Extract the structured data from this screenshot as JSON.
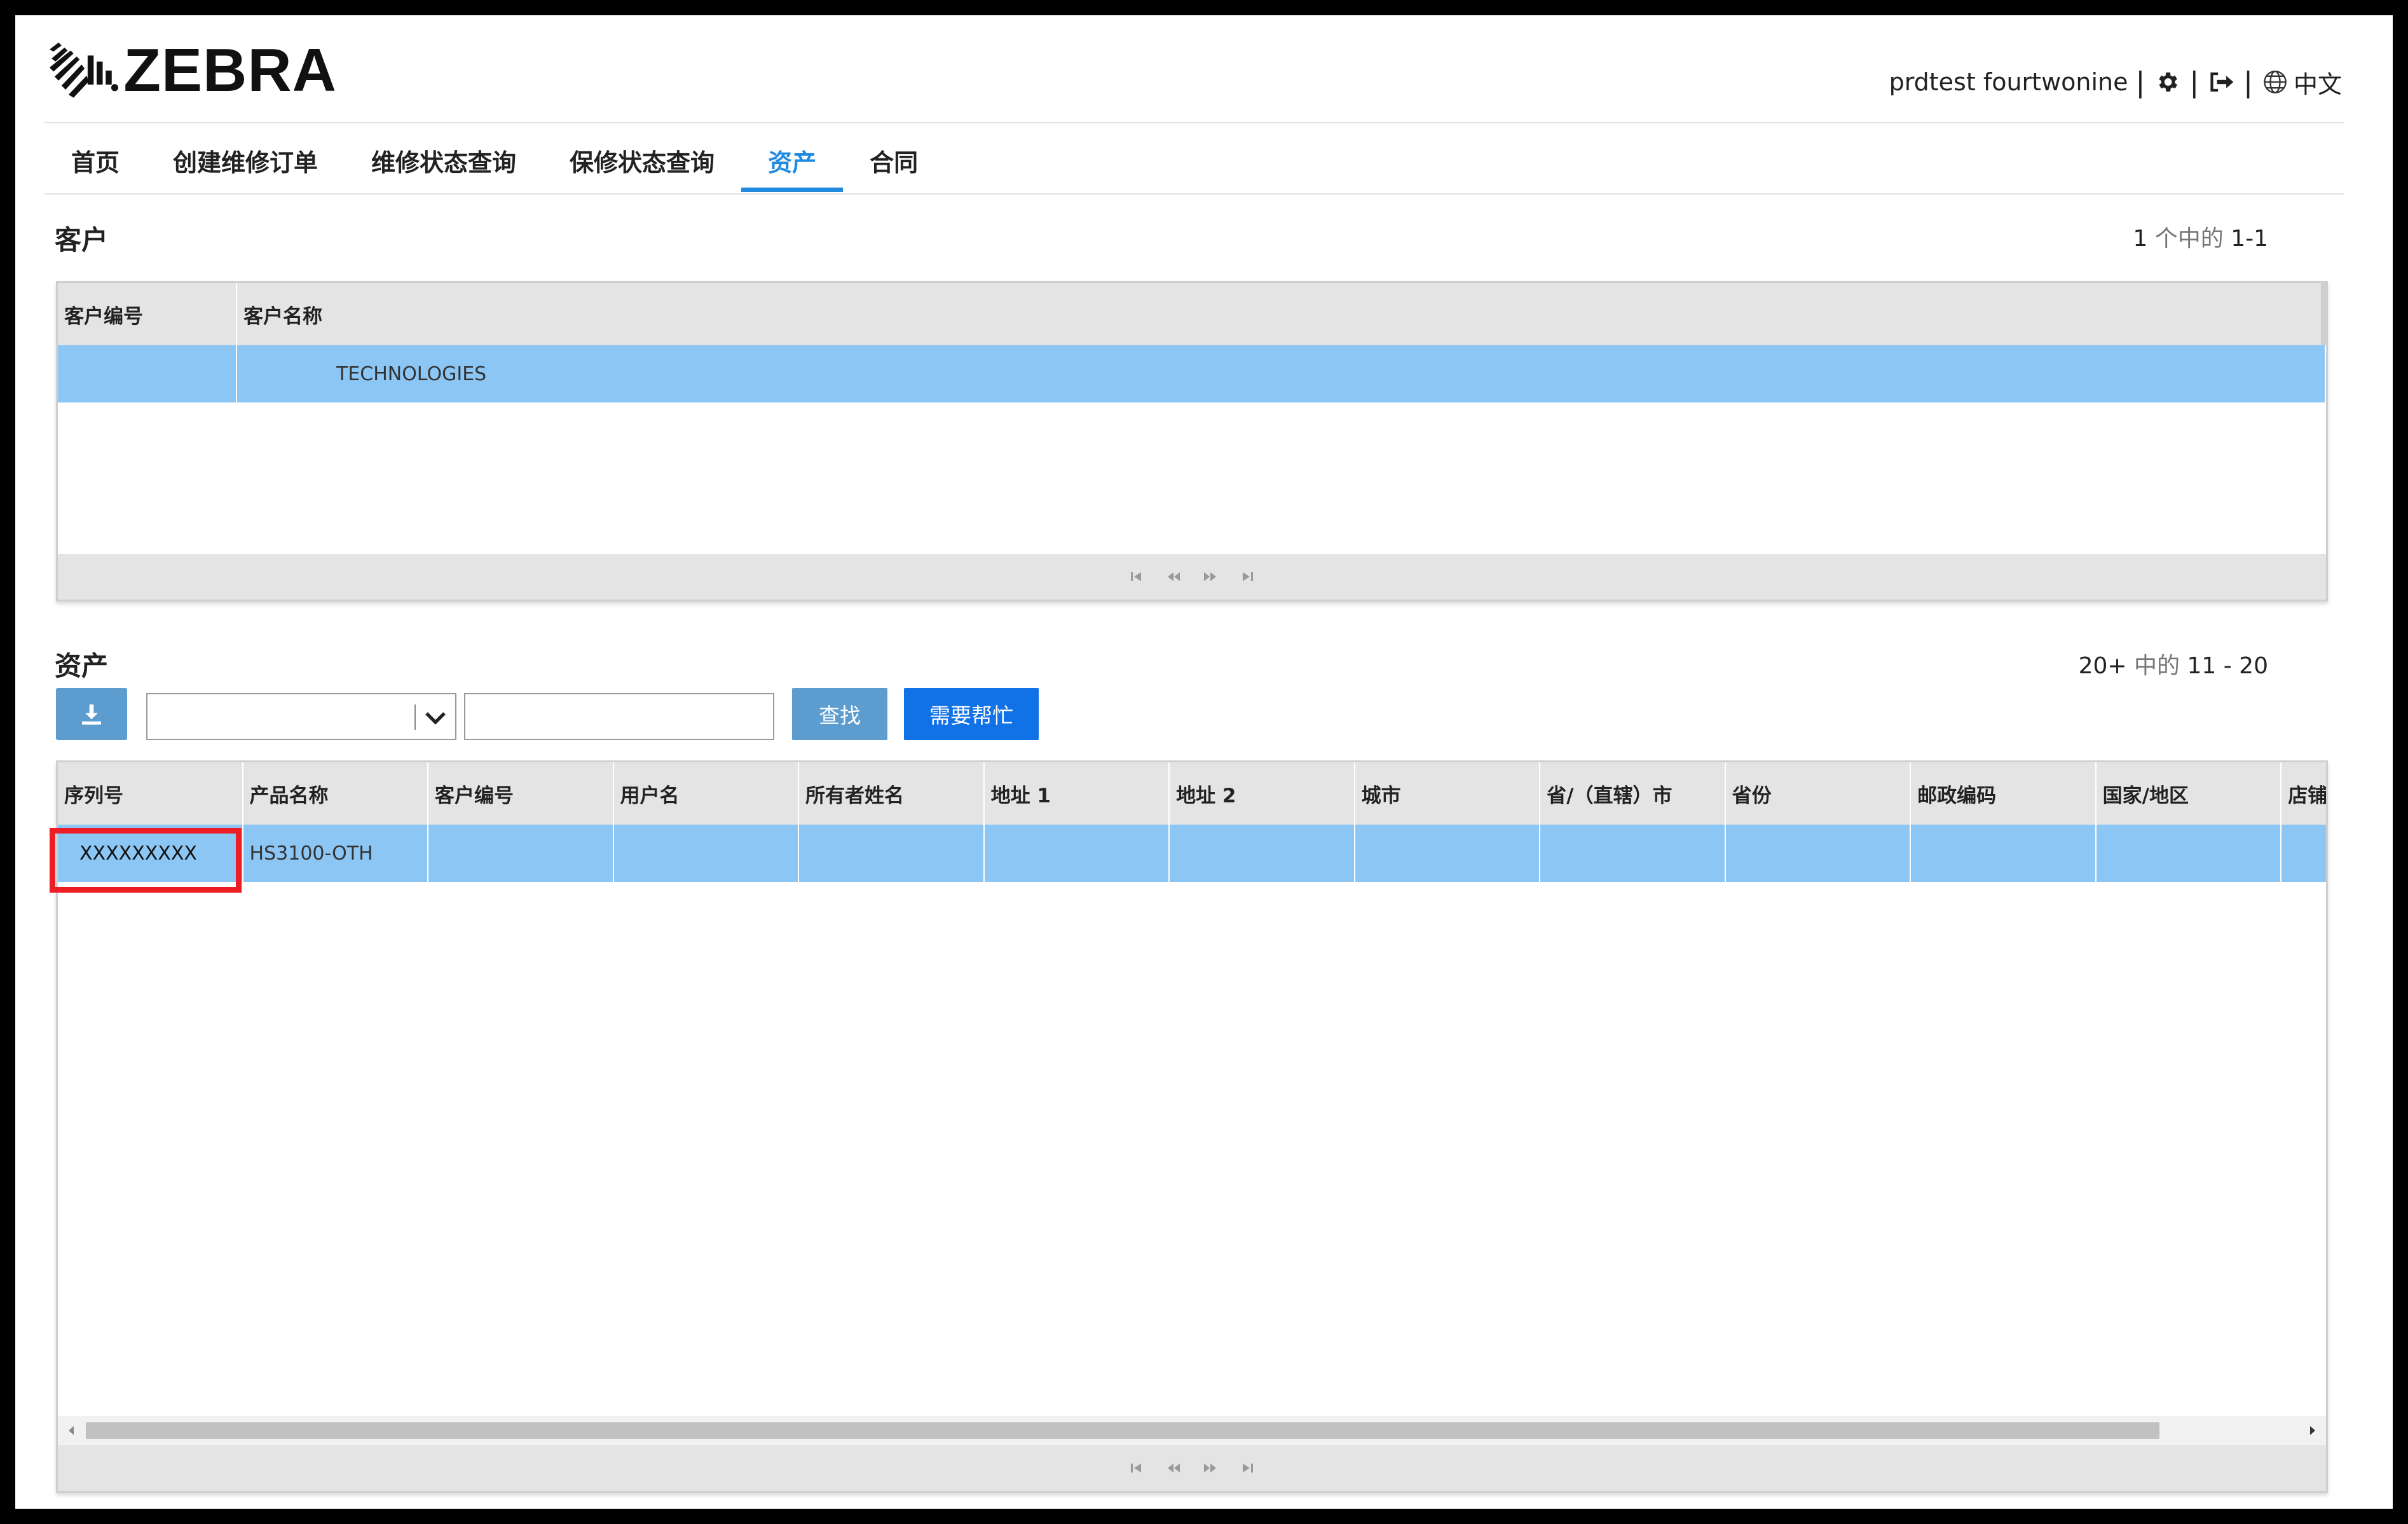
{
  "header": {
    "brand": "ZEBRA",
    "username": "prdtest fourtwonine",
    "language": "中文"
  },
  "nav": {
    "items": [
      {
        "label": "首页",
        "active": false
      },
      {
        "label": "创建维修订单",
        "active": false
      },
      {
        "label": "维修状态查询",
        "active": false
      },
      {
        "label": "保修状态查询",
        "active": false
      },
      {
        "label": "资产",
        "active": true
      },
      {
        "label": "合同",
        "active": false
      }
    ]
  },
  "customers": {
    "title": "客户",
    "pager": {
      "a": "1",
      "mid": "个中的",
      "b": "1-1"
    },
    "columns": [
      "客户编号",
      "客户名称"
    ],
    "rows": [
      {
        "number": "",
        "name": "TECHNOLOGIES"
      }
    ]
  },
  "assets": {
    "title": "资产",
    "pager": {
      "a": "20+",
      "mid": "中的",
      "b": "11 - 20"
    },
    "search_button": "查找",
    "help_button": "需要帮忙",
    "select_value": "",
    "search_value": "",
    "columns": [
      "序列号",
      "产品名称",
      "客户编号",
      "用户名",
      "所有者姓名",
      "地址 1",
      "地址 2",
      "城市",
      "省/（直辖）市",
      "省份",
      "邮政编码",
      "国家/地区",
      "店铺"
    ],
    "rows": [
      {
        "serial": "XXXXXXXXX",
        "product": "HS3100-OTH",
        "customer_no": "",
        "username": "",
        "owner": "",
        "address1": "",
        "address2": "",
        "city": "",
        "province_city": "",
        "province": "",
        "postal": "",
        "country": "",
        "store": ""
      }
    ]
  },
  "colors": {
    "accent": "#1f8ae0",
    "selected_row": "#8cc6f5",
    "button": "#5c9ccf",
    "help_button": "#1171e6",
    "highlight": "#ee1c24"
  }
}
